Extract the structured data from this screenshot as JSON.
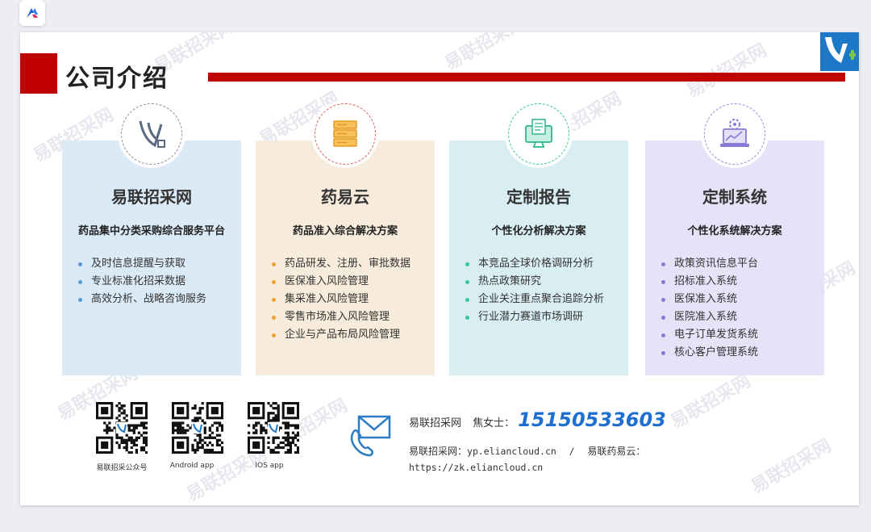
{
  "slide": {
    "title": "公司介绍",
    "watermark": "易联招采网",
    "brand_red": "#c00000"
  },
  "cards": [
    {
      "name": "易联招采网",
      "subtitle": "药品集中分类采购综合服务平台",
      "icon": "elian-logo-icon",
      "bg": "#dbeaf7",
      "ring": "#8a8f99",
      "dot": "#5b9bd5",
      "items": [
        "及时信息提醒与获取",
        "专业标准化招采数据",
        "高效分析、战略咨询服务"
      ]
    },
    {
      "name": "药易云",
      "subtitle": "药品准入综合解决方案",
      "icon": "server-icon",
      "bg": "#f7ecdb",
      "ring": "#e06060",
      "dot": "#f0a030",
      "items": [
        "药品研发、注册、审批数据",
        "医保准入风险管理",
        "集采准入风险管理",
        "零售市场准入风险管理",
        "企业与产品布局风险管理"
      ]
    },
    {
      "name": "定制报告",
      "subtitle": "个性化分析解决方案",
      "icon": "monitor-report-icon",
      "bg": "#d9eef3",
      "ring": "#38c79a",
      "dot": "#38c79a",
      "items": [
        "本竞品全球价格调研分析",
        "热点政策研究",
        "企业关注重点聚合追踪分析",
        "行业潜力赛道市场调研"
      ]
    },
    {
      "name": "定制系统",
      "subtitle": "个性化系统解决方案",
      "icon": "laptop-gear-icon",
      "bg": "#e4e3f8",
      "ring": "#9a88e0",
      "dot": "#8a78d8",
      "items": [
        "政策资讯信息平台",
        "招标准入系统",
        "医保准入系统",
        "医院准入系统",
        "电子订单发货系统",
        "核心客户管理系统"
      ]
    }
  ],
  "qr_codes": [
    {
      "label": "易联招采公众号"
    },
    {
      "label": "Android app"
    },
    {
      "label": "IOS app"
    }
  ],
  "contact": {
    "company": "易联招采网",
    "person": "焦女士：",
    "phone": "15150533603",
    "site1_label": "易联招采网：",
    "site1_url": "yp.eliancloud.cn",
    "separator": "/",
    "site2_label": "易联药易云：",
    "site2_url": "https://zk.eliancloud.cn"
  }
}
